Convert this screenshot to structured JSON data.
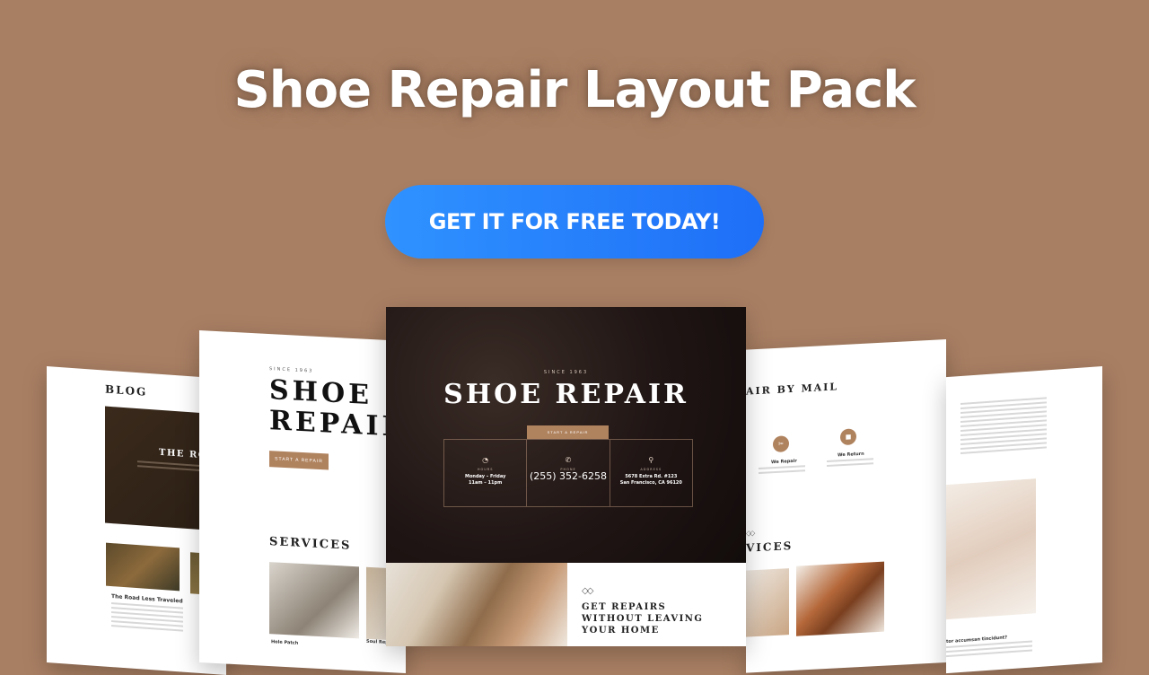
{
  "headline": "Shoe Repair Layout Pack",
  "cta_label": "GET IT FOR FREE TODAY!",
  "colors": {
    "background": "#a97f63",
    "cta_start": "#2f92ff",
    "cta_end": "#1e6ff7",
    "accent_brown": "#b0835f"
  },
  "far_left_card": {
    "section_title": "BLOG",
    "hero_title": "THE ROA",
    "post_title": "The Road Less Traveled"
  },
  "left_card": {
    "since": "SINCE 1963",
    "title_line1": "SHOE",
    "title_line2": "REPAIR",
    "button": "START A REPAIR",
    "services": "SERVICES",
    "caption1": "Hole Patch",
    "caption2": "Soul Repa"
  },
  "center_card": {
    "since": "SINCE 1963",
    "title": "SHOE REPAIR",
    "button": "START A REPAIR",
    "hours_label": "HOURS",
    "hours_value": "Monday – Friday",
    "hours_value2": "11am – 11pm",
    "phone_label": "PHONE",
    "phone_value": "(255) 352-6258",
    "address_label": "ADDRESS",
    "address_value": "5678 Extra Rd. #123",
    "address_value2": "San Francisco, CA 96120",
    "promo_line1": "GET REPAIRS",
    "promo_line2": "WITHOUT LEAVING",
    "promo_line3": "YOUR HOME"
  },
  "right_card": {
    "title": "AIR BY MAIL",
    "item1": "We Repair",
    "item2": "We Return",
    "services": "VICES"
  },
  "far_right_card": {
    "question": "tor accumsan tincidunt?"
  }
}
